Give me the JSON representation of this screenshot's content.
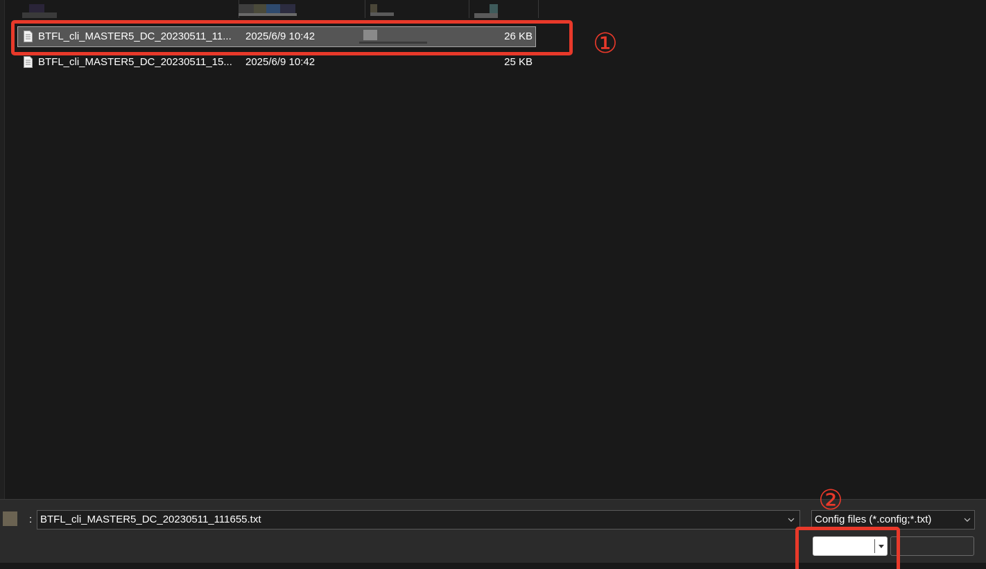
{
  "file_list": {
    "rows": [
      {
        "name": "BTFL_cli_MASTER5_DC_20230511_11...",
        "modified": "2025/6/9 10:42",
        "size": "26 KB",
        "selected": true,
        "icon": "text-file-icon"
      },
      {
        "name": "BTFL_cli_MASTER5_DC_20230511_15...",
        "modified": "2025/6/9 10:42",
        "size": "25 KB",
        "selected": false,
        "icon": "text-file-icon"
      }
    ]
  },
  "bottom_bar": {
    "filename_label_colon": ":",
    "filename_value": "BTFL_cli_MASTER5_DC_20230511_111655.txt",
    "filetype_value": "Config files (*.config;*.txt)",
    "open_button_icon": "dropdown-arrow-icon"
  },
  "annotations": [
    {
      "number": "①",
      "color": "#e8392a"
    },
    {
      "number": "②",
      "color": "#e8392a"
    }
  ],
  "colors": {
    "background": "#191919",
    "selected_row": "#555555",
    "annotation": "#e8392a",
    "panel": "#2b2b2b"
  }
}
